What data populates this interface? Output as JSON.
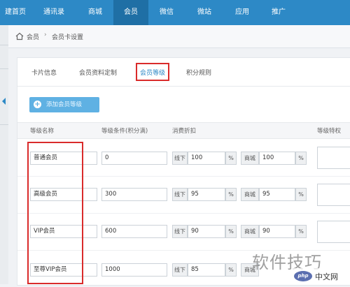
{
  "topnav": {
    "items": [
      "建首页",
      "通讯录",
      "商城",
      "会员",
      "微信",
      "微站",
      "应用",
      "推广"
    ],
    "active": "会员",
    "color": "#2d89c6"
  },
  "breadcrumb": {
    "items": [
      "会员",
      "会员卡设置"
    ]
  },
  "tabs": {
    "items": [
      "卡片信息",
      "会员资料定制",
      "会员等级",
      "积分规则"
    ],
    "active": "会员等级"
  },
  "add_button": {
    "label": "添加会员等级"
  },
  "table": {
    "headers": [
      "等级名称",
      "等级条件(积分满)",
      "消费折扣",
      "等级特权"
    ],
    "discount_labels": {
      "offline": "线下",
      "mall": "商城",
      "unit": "%"
    },
    "rows": [
      {
        "name": "普通会员",
        "condition": "0",
        "offline": "100",
        "mall": "100"
      },
      {
        "name": "高级会员",
        "condition": "300",
        "offline": "95",
        "mall": "95"
      },
      {
        "name": "VIP会员",
        "condition": "600",
        "offline": "90",
        "mall": "90"
      },
      {
        "name": "至尊VIP会员",
        "condition": "1000",
        "offline": "85",
        "mall": ""
      }
    ]
  },
  "watermark": {
    "text": "软件技巧",
    "site": "中文网",
    "logo": "php"
  },
  "colors": {
    "highlight": "#d92b2b",
    "accent": "#2d89c6"
  }
}
